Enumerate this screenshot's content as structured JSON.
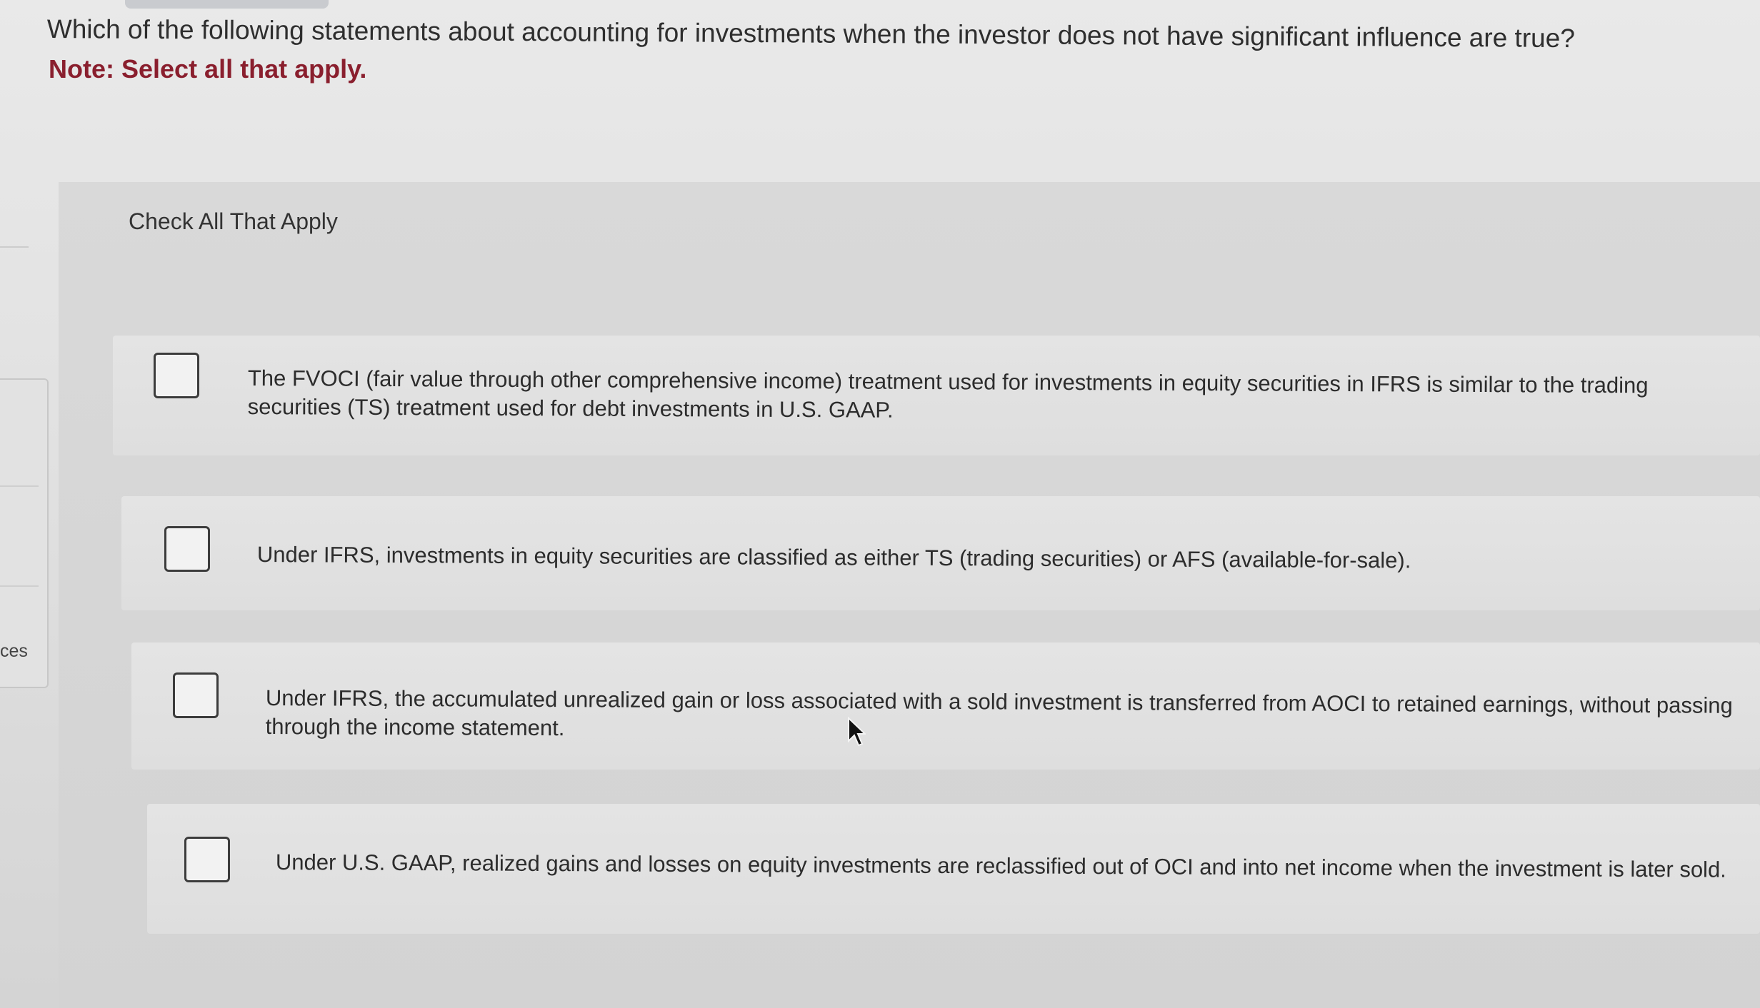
{
  "question": {
    "text": "Which of the following statements about accounting for investments when the investor does not have significant influence are true?",
    "note": "Note: Select all that apply."
  },
  "left_panel": {
    "tab_label": "ces"
  },
  "panel": {
    "title": "Check All That Apply"
  },
  "options": [
    {
      "text": "The FVOCI (fair value through other comprehensive income) treatment used for investments in equity securities in IFRS is similar to the trading securities (TS) treatment used for debt investments in U.S. GAAP.",
      "checked": false
    },
    {
      "text": "Under IFRS, investments in equity securities are classified as either TS (trading securities) or AFS (available-for-sale).",
      "checked": false
    },
    {
      "text": "Under IFRS, the accumulated unrealized gain or loss associated with a sold investment is transferred from AOCI to retained earnings, without passing through the income statement.",
      "checked": false
    },
    {
      "text": "Under U.S. GAAP, realized gains and losses on equity investments are reclassified out of OCI and into net income when the investment is later sold.",
      "checked": false
    }
  ],
  "colors": {
    "note": "#8a1f2e",
    "background": "#e1e1e1",
    "panel": "#d6d6d6",
    "checkbox_border": "#3c3c3c"
  },
  "icons": {
    "cursor": "mouse-pointer-icon"
  }
}
